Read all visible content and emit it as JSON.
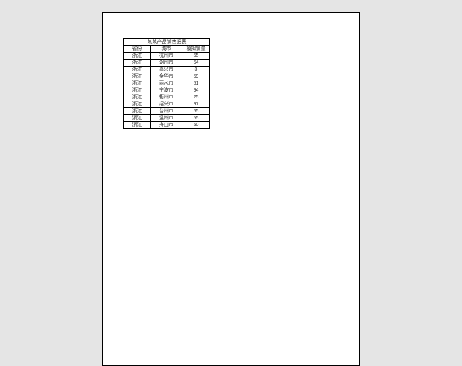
{
  "chart_data": {
    "type": "table",
    "title": "某某产品销售报表",
    "columns": [
      "省份",
      "城市",
      "模拟销量"
    ],
    "rows": [
      [
        "浙江",
        "杭州市",
        55
      ],
      [
        "浙江",
        "湖州市",
        54
      ],
      [
        "浙江",
        "嘉兴市",
        3
      ],
      [
        "浙江",
        "金华市",
        59
      ],
      [
        "浙江",
        "丽水市",
        51
      ],
      [
        "浙江",
        "宁波市",
        94
      ],
      [
        "浙江",
        "衢州市",
        25
      ],
      [
        "浙江",
        "绍兴市",
        97
      ],
      [
        "浙江",
        "台州市",
        55
      ],
      [
        "浙江",
        "温州市",
        55
      ],
      [
        "浙江",
        "舟山市",
        50
      ]
    ]
  }
}
